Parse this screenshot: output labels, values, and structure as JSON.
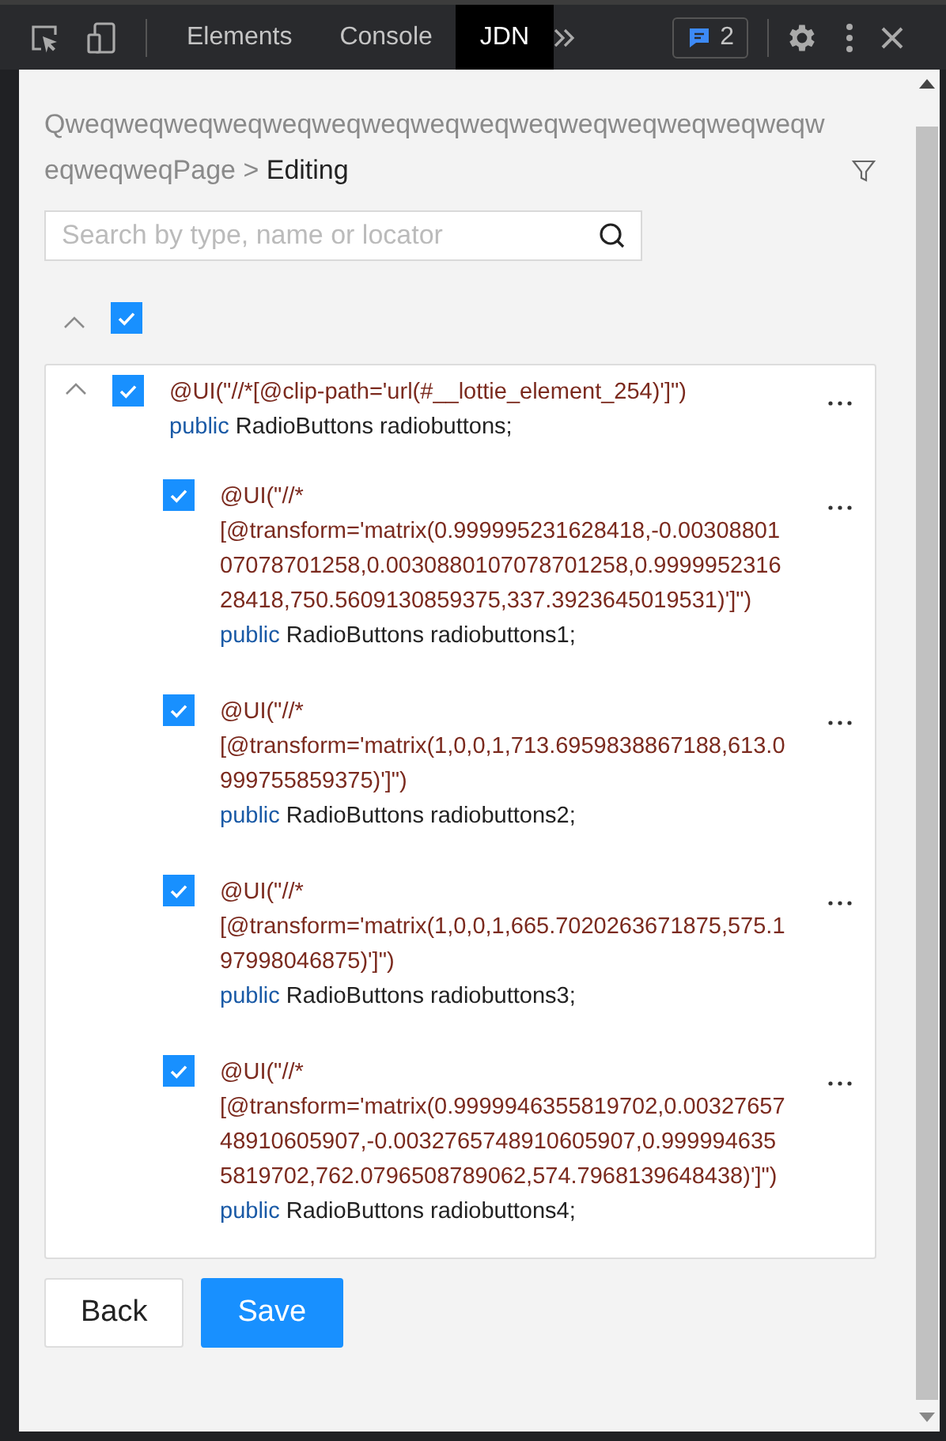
{
  "toolbar": {
    "tabs": [
      {
        "label": "Elements",
        "selected": false
      },
      {
        "label": "Console",
        "selected": false
      },
      {
        "label": "JDN",
        "selected": true
      }
    ],
    "issues_count": "2"
  },
  "breadcrumb": {
    "path": "QweqweqweqweqweqweqweqweqweqweqweqweqweqweqweqweqweqweqPage",
    "separator": ">",
    "current": "Editing"
  },
  "search": {
    "placeholder": "Search by type, name or locator"
  },
  "tree": {
    "expanded": true,
    "checked": true,
    "children": [
      {
        "expanded": true,
        "checked": true,
        "annotation": "@UI(\"//*[@clip-path='url(#__lottie_element_254)']\")",
        "modifier": "public",
        "declaration": "RadioButtons radiobuttons;",
        "children": [
          {
            "checked": true,
            "annotation": "@UI(\"//*[@transform='matrix(0.999995231628418,-0.0030880107078701258,0.0030880107078701258,0.999995231628418,750.5609130859375,337.3923645019531)']\")",
            "modifier": "public",
            "declaration": "RadioButtons radiobuttons1;"
          },
          {
            "checked": true,
            "annotation": "@UI(\"//*[@transform='matrix(1,0,0,1,713.6959838867188,613.0999755859375)']\")",
            "modifier": "public",
            "declaration": "RadioButtons radiobuttons2;"
          },
          {
            "checked": true,
            "annotation": "@UI(\"//*[@transform='matrix(1,0,0,1,665.7020263671875,575.197998046875)']\")",
            "modifier": "public",
            "declaration": "RadioButtons radiobuttons3;"
          },
          {
            "checked": true,
            "annotation": "@UI(\"//*[@transform='matrix(0.9999946355819702,0.0032765748910605907,-0.0032765748910605907,0.9999946355819702,762.0796508789062,574.7968139648438)']\")",
            "modifier": "public",
            "declaration": "RadioButtons radiobuttons4;"
          }
        ]
      }
    ]
  },
  "buttons": [
    {
      "label": "Back",
      "kind": "secondary"
    },
    {
      "label": "Save",
      "kind": "primary"
    }
  ]
}
